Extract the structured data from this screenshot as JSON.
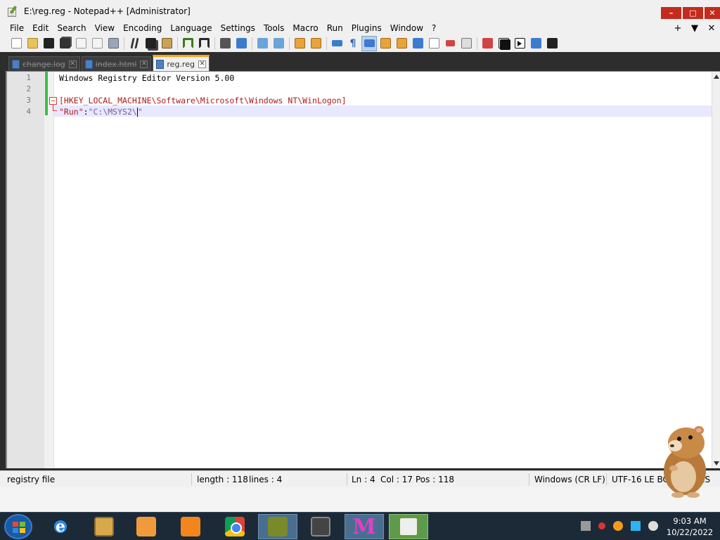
{
  "window": {
    "title": "E:\\reg.reg - Notepad++ [Administrator]",
    "controls": {
      "minimize": "–",
      "maximize": "□",
      "close": "✕"
    }
  },
  "menu": {
    "items": [
      "File",
      "Edit",
      "Search",
      "View",
      "Encoding",
      "Language",
      "Settings",
      "Tools",
      "Macro",
      "Run",
      "Plugins",
      "Window",
      "?"
    ],
    "right": [
      "+",
      "▼",
      "✕"
    ]
  },
  "toolbar": {
    "icons": [
      "new-file-icon",
      "open-file-icon",
      "save-icon",
      "save-all-icon",
      "close-icon",
      "close-all-icon",
      "print-icon",
      "cut-icon",
      "copy-icon",
      "paste-icon",
      "undo-icon",
      "redo-icon",
      "find-icon",
      "replace-icon",
      "zoom-in-icon",
      "zoom-out-icon",
      "sync-vertical-icon",
      "sync-horizontal-icon",
      "word-wrap-icon",
      "show-all-characters-icon",
      "indent-guide-icon",
      "user-language-icon",
      "document-map-icon",
      "function-list-icon",
      "folder-as-workspace-icon",
      "monitoring-icon",
      "record-macro-icon",
      "stop-recording-icon",
      "playback-macro-icon",
      "run-macro-multiple-icon",
      "save-macro-icon"
    ],
    "pilcrow": "¶"
  },
  "tabs": [
    {
      "label": "change.log",
      "active": false
    },
    {
      "label": "index.html",
      "active": false
    },
    {
      "label": "reg.reg",
      "active": true
    }
  ],
  "tab_close_glyph": "✕",
  "editor": {
    "line_numbers": [
      "1",
      "2",
      "3",
      "4"
    ],
    "line1": "Windows Registry Editor Version 5.00",
    "line3": "[HKEY_LOCAL_MACHINE\\Software\\Microsoft\\Windows NT\\WinLogon]",
    "line4_key": "\"Run\"",
    "line4_eq": ":",
    "line4_value": "\"C:\\MSYS2\\",
    "line4_end": "\""
  },
  "status": {
    "file_type": "registry file",
    "length": "length : 118",
    "lines": "lines : 4",
    "ln": "Ln : 4",
    "col": "Col : 17",
    "pos": "Pos : 118",
    "eol": "Windows (CR LF)",
    "encoding": "UTF-16 LE BOM",
    "ins": "INS"
  },
  "taskbar": {
    "apps": [
      "windows-start",
      "internet-explorer",
      "file-explorer",
      "media-player",
      "uc-browser",
      "google-chrome",
      "box-app",
      "clock-app",
      "m-app",
      "notepad-plus-plus"
    ],
    "m_letter": "M",
    "ie_letter": "e",
    "time": "9:03 AM",
    "date": "10/22/2022"
  }
}
